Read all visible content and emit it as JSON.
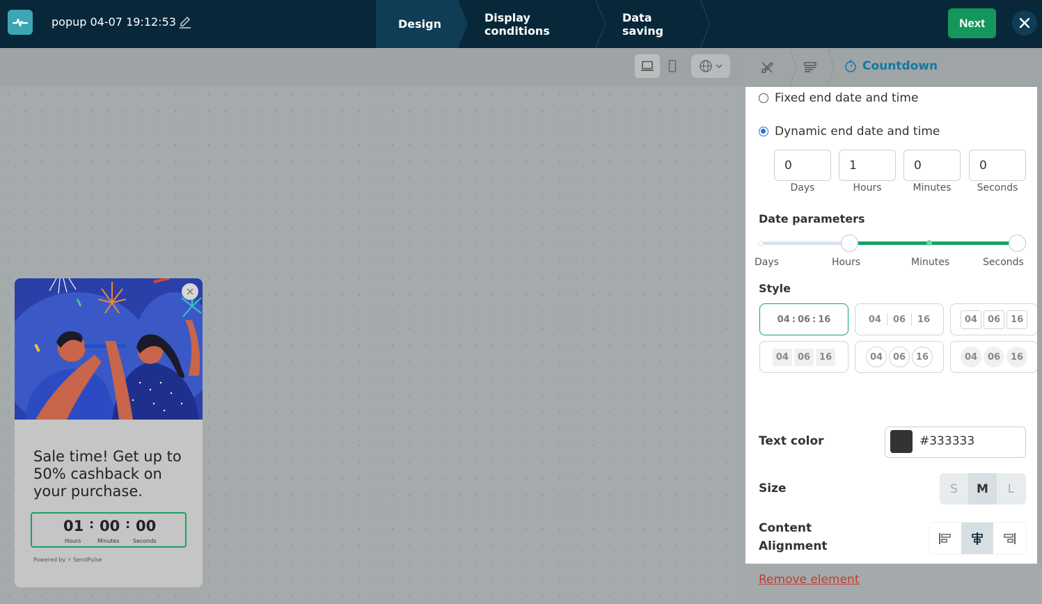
{
  "header": {
    "title": "popup 04-07 19:12:53",
    "steps": [
      "Design",
      "Display conditions",
      "Data saving"
    ],
    "next_label": "Next"
  },
  "popup": {
    "text": "Sale time! Get up to 50% cashback on your purchase.",
    "timer": {
      "hours": "01",
      "minutes": "00",
      "seconds": "00",
      "sep": ":",
      "labels": [
        "Hours",
        "Minutes",
        "Seconds"
      ]
    },
    "powered": "Powered by ⚡ SendPulse"
  },
  "panel": {
    "breadcrumb_active": "Countdown",
    "radio_fixed": "Fixed end date and time",
    "radio_dynamic": "Dynamic end date and time",
    "selected_mode": "dynamic",
    "fields": [
      {
        "value": "0",
        "label": "Days"
      },
      {
        "value": "1",
        "label": "Hours"
      },
      {
        "value": "0",
        "label": "Minutes"
      },
      {
        "value": "0",
        "label": "Seconds"
      }
    ],
    "date_params_label": "Date parameters",
    "slider_labels": [
      "Days",
      "Hours",
      "Minutes",
      "Seconds"
    ],
    "slider_range": [
      "Hours",
      "Seconds"
    ],
    "style_label": "Style",
    "style_sample": {
      "a": "04",
      "b": "06",
      "c": "16",
      "sep": ":"
    },
    "text_color_label": "Text color",
    "text_color_value": "#333333",
    "size_label": "Size",
    "sizes": [
      "S",
      "M",
      "L"
    ],
    "size_selected": "M",
    "content_alignment_label_1": "Content",
    "content_alignment_label_2": "Alignment",
    "alignment_selected": "center",
    "remove_label": "Remove element"
  },
  "colors": {
    "accent_green": "#14975d",
    "link_blue": "#1477a0",
    "danger": "#c43b2a",
    "topbar": "#08283a"
  }
}
